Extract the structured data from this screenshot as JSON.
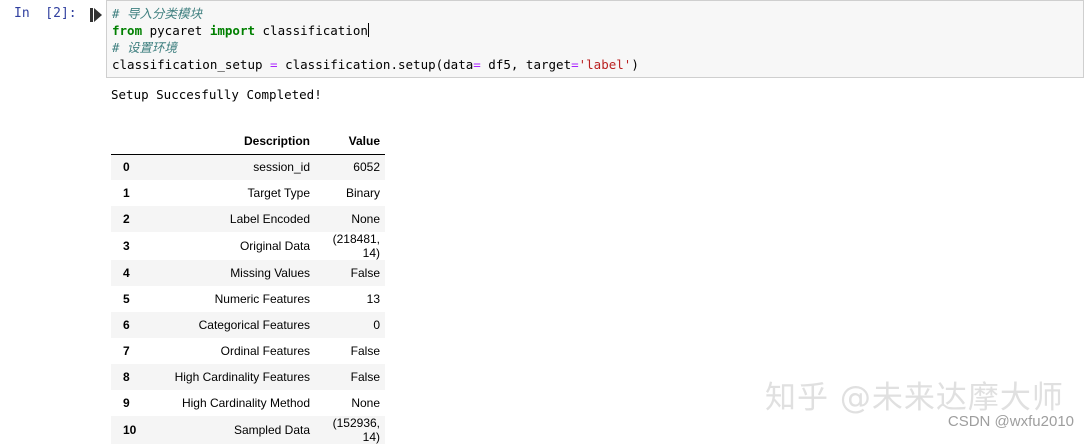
{
  "cell": {
    "prompt": "In  [2]:",
    "code_lines": [
      {
        "comment": "# 导入分类模块"
      },
      {
        "kw1": "from",
        "mod": " pycaret ",
        "kw2": "import",
        "name": " classification"
      },
      {
        "comment": "# 设置环境"
      },
      {
        "pre": "classification_setup ",
        "eq": "=",
        "call": " classification.setup(data",
        "eq2": "=",
        "args": " df5, target",
        "eq3": "=",
        "str": "'label'",
        "close": ")"
      }
    ]
  },
  "output": {
    "message": "Setup Succesfully Completed!",
    "table": {
      "headers": [
        "",
        "Description",
        "Value"
      ],
      "rows": [
        {
          "index": "0",
          "description": "session_id",
          "value": "6052"
        },
        {
          "index": "1",
          "description": "Target Type",
          "value": "Binary"
        },
        {
          "index": "2",
          "description": "Label Encoded",
          "value": "None"
        },
        {
          "index": "3",
          "description": "Original Data",
          "value": "(218481, 14)"
        },
        {
          "index": "4",
          "description": "Missing Values",
          "value": "False"
        },
        {
          "index": "5",
          "description": "Numeric Features",
          "value": "13"
        },
        {
          "index": "6",
          "description": "Categorical Features",
          "value": "0"
        },
        {
          "index": "7",
          "description": "Ordinal Features",
          "value": "False"
        },
        {
          "index": "8",
          "description": "High Cardinality Features",
          "value": "False"
        },
        {
          "index": "9",
          "description": "High Cardinality Method",
          "value": "None"
        },
        {
          "index": "10",
          "description": "Sampled Data",
          "value": "(152936, 14)"
        }
      ]
    }
  },
  "watermarks": {
    "zhihu": "知乎 @未来达摩大师",
    "csdn": "CSDN @wxfu2010"
  },
  "colors": {
    "prompt": "#303f9f",
    "keyword": "#008000",
    "comment": "#408080",
    "string": "#ba2121",
    "operator": "#aa22ff",
    "cell_bg": "#f7f7f7",
    "cell_border": "#cfcfcf"
  }
}
